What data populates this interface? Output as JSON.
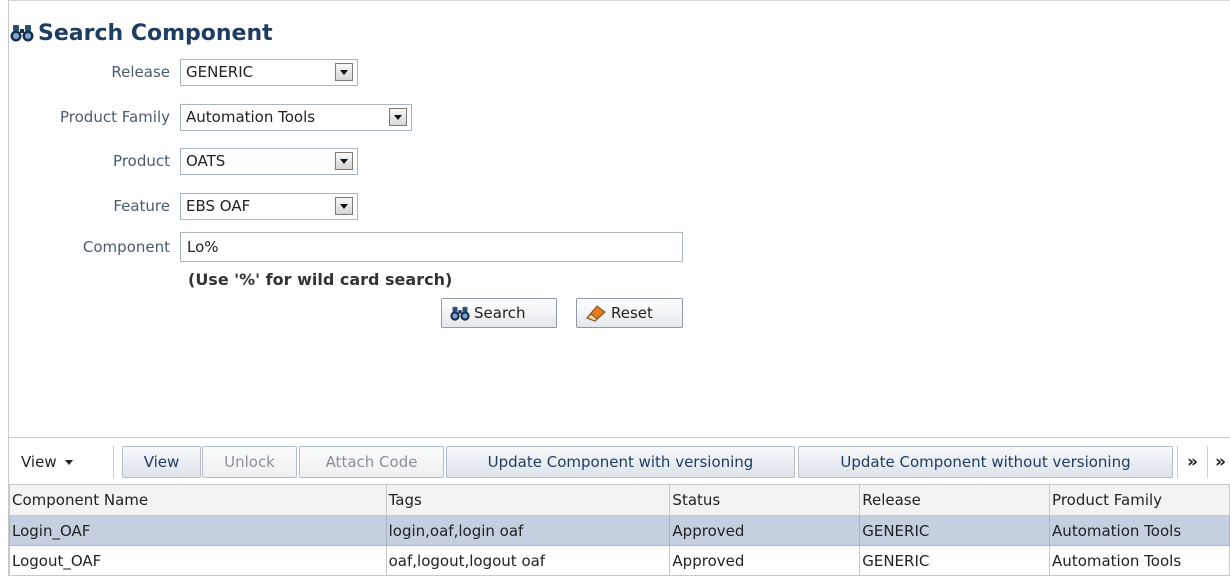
{
  "header": {
    "title": "Search Component",
    "icon": "binoculars-icon"
  },
  "form": {
    "release": {
      "label": "Release",
      "value": "GENERIC"
    },
    "product_family": {
      "label": "Product Family",
      "value": "Automation Tools"
    },
    "product": {
      "label": "Product",
      "value": "OATS"
    },
    "feature": {
      "label": "Feature",
      "value": "EBS OAF"
    },
    "component": {
      "label": "Component",
      "value": "Lo%"
    },
    "hint": "(Use '%' for wild card search)",
    "search_label": "Search",
    "reset_label": "Reset"
  },
  "toolbar": {
    "view_menu": "View",
    "view_btn": "View",
    "unlock": "Unlock",
    "attach_code": "Attach Code",
    "update_with": "Update Component with versioning",
    "update_without": "Update Component without versioning",
    "more1": "»",
    "more2": "»"
  },
  "table": {
    "columns": [
      "Component Name",
      "Tags",
      "Status",
      "Release",
      "Product Family"
    ],
    "rows": [
      {
        "name": "Login_OAF",
        "tags": "login,oaf,login oaf",
        "status": "Approved",
        "release": "GENERIC",
        "family": "Automation Tools",
        "selected": true
      },
      {
        "name": "Logout_OAF",
        "tags": "oaf,logout,logout oaf",
        "status": "Approved",
        "release": "GENERIC",
        "family": "Automation Tools",
        "selected": false
      }
    ]
  },
  "colors": {
    "title": "#1f3d63",
    "label": "#4a5c70",
    "selected_row": "#c5cfe0"
  }
}
